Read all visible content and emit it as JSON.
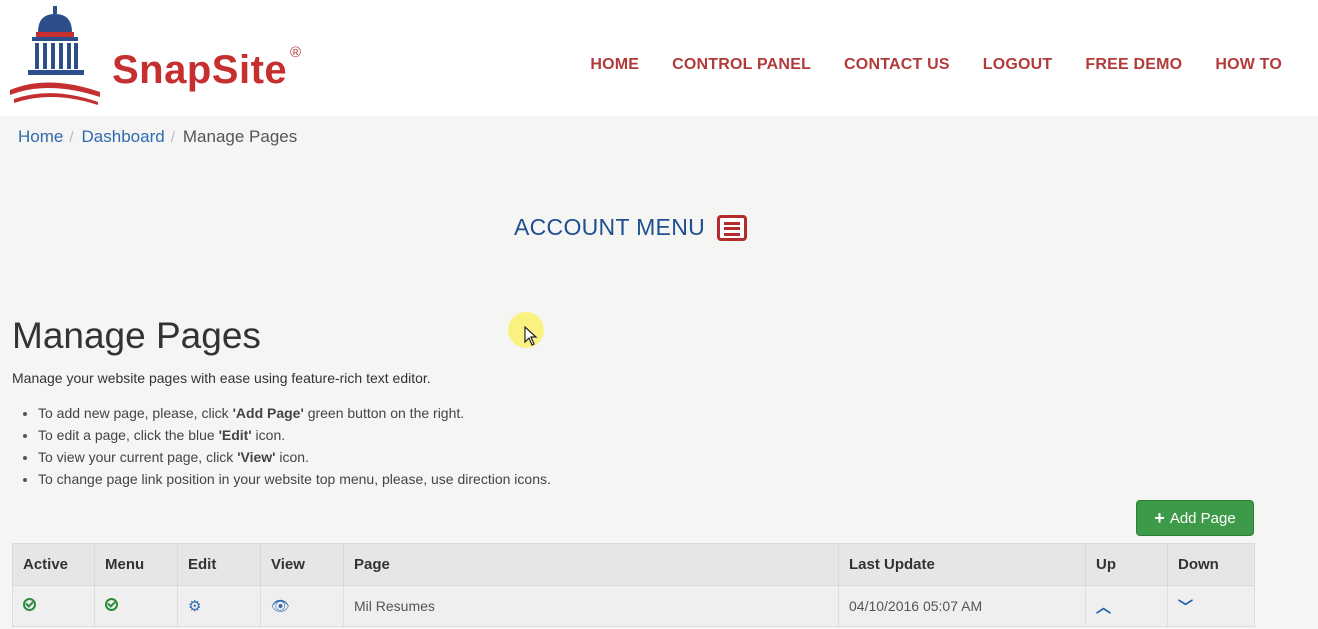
{
  "brand": {
    "name": "SnapSite",
    "registered": "®"
  },
  "nav": {
    "items": [
      "HOME",
      "CONTROL PANEL",
      "CONTACT US",
      "LOGOUT",
      "FREE DEMO",
      "HOW TO"
    ]
  },
  "breadcrumb": {
    "items": [
      "Home",
      "Dashboard"
    ],
    "current": "Manage Pages",
    "separator": "/"
  },
  "account_menu": {
    "label": "ACCOUNT MENU",
    "icon": "hamburger-menu-icon"
  },
  "page": {
    "title": "Manage Pages",
    "intro": "Manage your website pages with ease using feature-rich text editor.",
    "bullets": [
      {
        "before": "To add new page, please, click ",
        "bold": "'Add Page'",
        "after": " green button on the right."
      },
      {
        "before": "To edit a page, click the blue ",
        "bold": "'Edit'",
        "after": " icon."
      },
      {
        "before": "To view your current page, click ",
        "bold": "'View'",
        "after": " icon."
      },
      {
        "before": "To change page link position in your website top menu, please, use direction icons.",
        "bold": "",
        "after": ""
      }
    ]
  },
  "add_page_button": {
    "label": "Add Page",
    "icon": "plus-icon",
    "color": "#3c9a48"
  },
  "table": {
    "headers": [
      "Active",
      "Menu",
      "Edit",
      "View",
      "Page",
      "Last Update",
      "Up",
      "Down"
    ],
    "rows": [
      {
        "active_icon": "check-circle-icon",
        "menu_icon": "check-circle-icon",
        "edit_icon": "gear-icon",
        "view_icon": "eye-icon",
        "page": "Mil Resumes",
        "last_update": "04/10/2016 05:07 AM",
        "up_icon": "chevron-up-icon",
        "down_icon": "chevron-down-icon"
      }
    ]
  },
  "colors": {
    "brand_red": "#c62f2f",
    "nav_red": "#b23a3a",
    "link_blue": "#2f6ab0",
    "account_blue": "#1f4f8e",
    "success_green": "#3c9a48"
  }
}
